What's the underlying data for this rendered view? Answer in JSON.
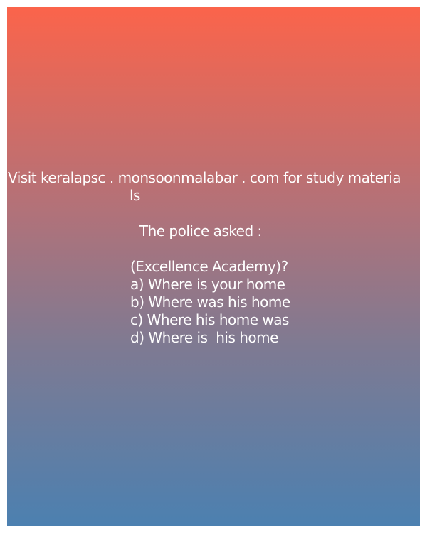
{
  "post": {
    "line1": "Visit keralapsc . monsoonmalabar . com for study materia",
    "line2": "ls",
    "question": " The police asked :",
    "source": "(Excellence Academy)?",
    "options": [
      "a) Where is your home",
      "b) Where was his home",
      "c) Where his home was",
      "d) Where is  his home"
    ]
  },
  "colors": {
    "gradient_top": "#fb644b",
    "gradient_bottom": "#4c80b0",
    "text": "#ffffff"
  }
}
